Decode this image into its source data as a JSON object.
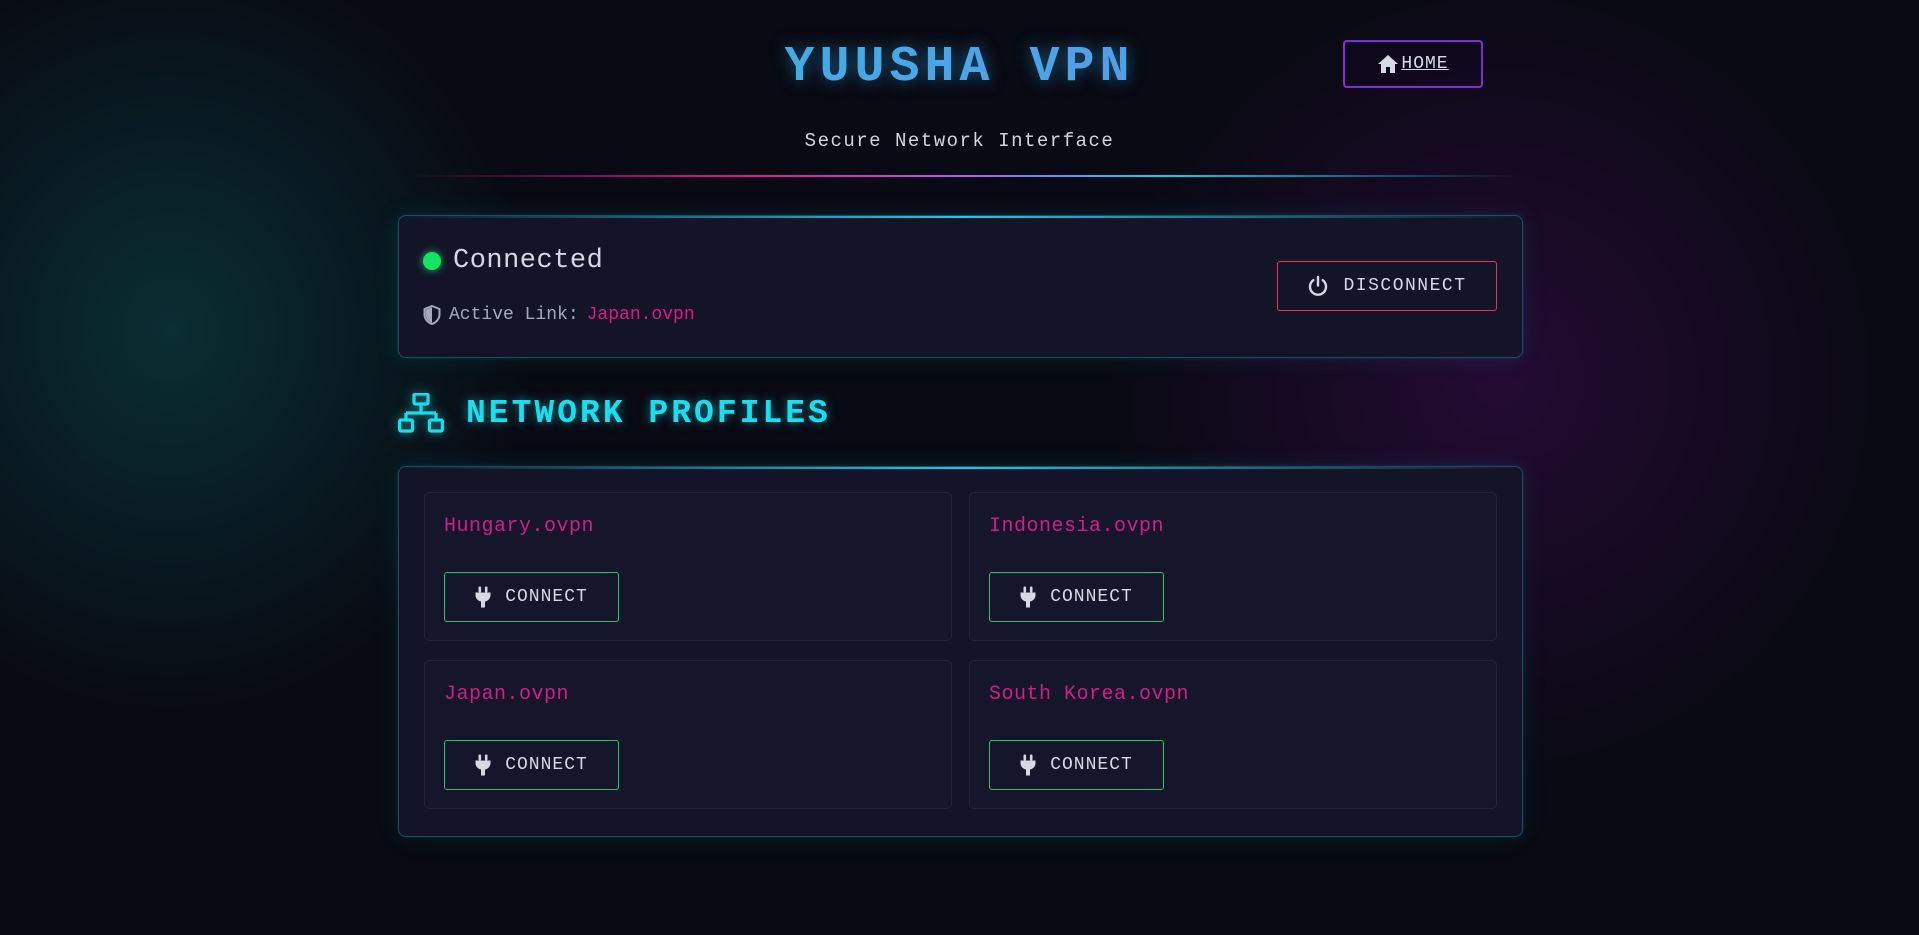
{
  "header": {
    "title": "YUUSHA VPN",
    "subtitle": "Secure Network Interface",
    "home_label": " HOME",
    "home_icon": "home-icon"
  },
  "status": {
    "state": "Connected",
    "indicator_color": "#13e563",
    "active_link_label": "Active Link:",
    "active_link_value": "Japan.ovpn",
    "disconnect_label": "DISCONNECT",
    "disconnect_icon": "power-icon"
  },
  "profiles": {
    "heading": "NETWORK PROFILES",
    "heading_icon": "network-icon",
    "items": [
      {
        "name": "Hungary.ovpn",
        "button_label": "CONNECT"
      },
      {
        "name": "Indonesia.ovpn",
        "button_label": "CONNECT"
      },
      {
        "name": "Japan.ovpn",
        "button_label": "CONNECT"
      },
      {
        "name": "South Korea.ovpn",
        "button_label": "CONNECT"
      }
    ]
  },
  "colors": {
    "accent_cyan": "#16dff0",
    "accent_magenta": "#e0168a",
    "connect_border": "#1fc767",
    "disconnect_border": "#e8315f",
    "home_border": "#7b2fd6",
    "background": "#090a13"
  }
}
